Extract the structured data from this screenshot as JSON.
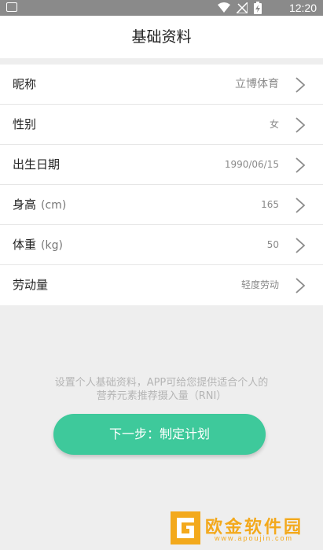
{
  "status_bar": {
    "time": "12:20"
  },
  "header": {
    "title": "基础资料"
  },
  "profile_rows": [
    {
      "label": "昵称",
      "unit": "",
      "value": "立博体育"
    },
    {
      "label": "性别",
      "unit": "",
      "value": "女"
    },
    {
      "label": "出生日期",
      "unit": "",
      "value": "1990/06/15"
    },
    {
      "label": "身高",
      "unit": "(cm)",
      "value": "165"
    },
    {
      "label": "体重",
      "unit": "(kg)",
      "value": "50"
    },
    {
      "label": "劳动量",
      "unit": "",
      "value": "轻度劳动"
    }
  ],
  "hint": {
    "line1": "设置个人基础资料，APP可给您提供适合个人的",
    "line2": "营养元素推荐摄入量（RNI）"
  },
  "next_button": {
    "label": "下一步：制定计划"
  },
  "watermark": {
    "name": "欧金软件园",
    "url": "www.apoujin.com"
  },
  "colors": {
    "accent": "#3ec99b",
    "watermark": "#f3a91c",
    "status_bar": "#8a8a8a"
  }
}
